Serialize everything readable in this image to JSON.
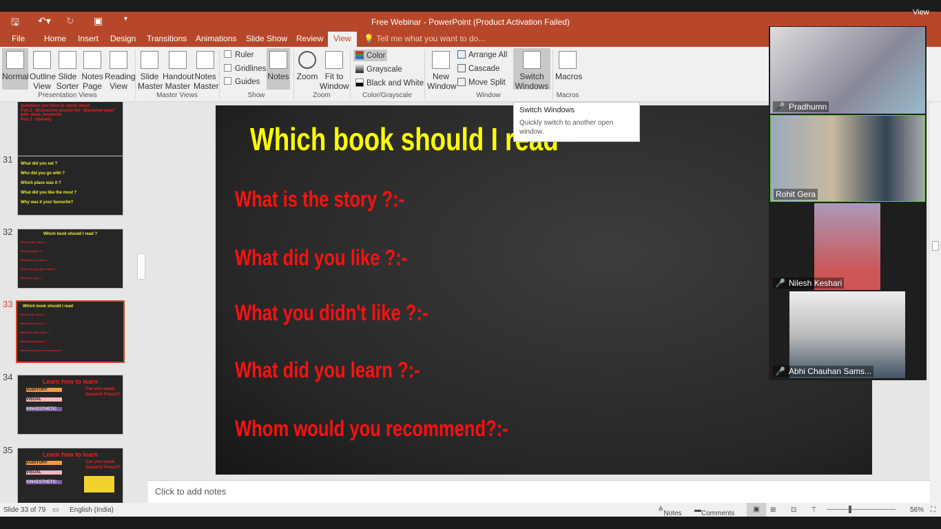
{
  "window": {
    "title": "Free Webinar - PowerPoint (Product Activation Failed)",
    "view_label": "View"
  },
  "tabs": [
    "File",
    "Home",
    "Insert",
    "Design",
    "Transitions",
    "Animations",
    "Slide Show",
    "Review",
    "View"
  ],
  "tell_me": "Tell me what you want to do...",
  "ribbon": {
    "presentation_views": {
      "label": "Presentation Views",
      "buttons": [
        [
          "Normal",
          ""
        ],
        [
          "Outline",
          "View"
        ],
        [
          "Slide",
          "Sorter"
        ],
        [
          "Notes",
          "Page"
        ],
        [
          "Reading",
          "View"
        ]
      ]
    },
    "master_views": {
      "label": "Master Views",
      "buttons": [
        [
          "Slide",
          "Master"
        ],
        [
          "Handout",
          "Master"
        ],
        [
          "Notes",
          "Master"
        ]
      ]
    },
    "show": {
      "label": "Show",
      "checks": [
        "Ruler",
        "Gridlines",
        "Guides"
      ],
      "notes": "Notes"
    },
    "zoom": {
      "label": "Zoom",
      "zoom": "Zoom",
      "fit": [
        "Fit to",
        "Window"
      ]
    },
    "color": {
      "label": "Color/Grayscale",
      "items": [
        "Color",
        "Grayscale",
        "Black and White"
      ]
    },
    "window": {
      "label": "Window",
      "new": [
        "New",
        "Window"
      ],
      "items": [
        "Arrange All",
        "Cascade",
        "Move Split"
      ],
      "switch": [
        "Switch",
        "Windows"
      ]
    },
    "macros": {
      "label": "Macros",
      "button": "Macros"
    }
  },
  "tooltip": {
    "title": "Switch Windows",
    "text": "Quickly switch to another open window."
  },
  "thumbnails": [
    {
      "num": "",
      "lines": [
        "questions you have to speak about",
        "Part 2 - Brainstorm around the \"dissected topic\" with ideas, keywords",
        "Part 3 - Delivery"
      ]
    },
    {
      "num": "31",
      "lines": [
        "What did you eat ?",
        "Who did you go with ?",
        "Which place was it ?",
        "What did you like the most ?",
        "Why was it your favourite?"
      ]
    },
    {
      "num": "32",
      "title": "Which book should I read ?",
      "lines": [
        "What is the name ?:-",
        "Who is author ?:-",
        "What did you read ?:-",
        "Where do you get it from?:-",
        "Who told you ?:-"
      ]
    },
    {
      "num": "33",
      "title": "Which book should I read",
      "lines": [
        "What is the story ?:-",
        "What did you like ?:-",
        "What you didn't like ?:-",
        "What did you learn ?:-",
        "Whom would you recommend?:-"
      ]
    },
    {
      "num": "34",
      "title": "Learn how to learn",
      "tags": [
        "AUDITORY",
        "VISUAL",
        "KINAESTHETIC"
      ],
      "side": "Can you speak Sanskrit/ French?"
    },
    {
      "num": "35",
      "title": "Learn how to learn",
      "tags": [
        "AUDITORY",
        "VISUAL",
        "KINAESTHETIC"
      ],
      "side": "Can you speak Sanskrit/ French?"
    }
  ],
  "slide": {
    "title": "Which book should I read",
    "questions": [
      "What is the story ?:-",
      "What did you like ?:-",
      "What you didn't like ?:-",
      "What did you learn ?:-",
      "Whom would you recommend?:-"
    ]
  },
  "notes_placeholder": "Click to add notes",
  "status": {
    "slide": "Slide 33 of 79",
    "language": "English (India)",
    "notes": "Notes",
    "comments": "Comments",
    "zoom": "56%"
  },
  "participants": [
    "Pradhumn",
    "Rohit Gera",
    "Nilesh Keshari",
    "Abhi Chauhan Sams..."
  ],
  "colors": {
    "accent": "#b7472a",
    "slide_title": "#ffff00",
    "slide_text": "#ff1010"
  }
}
